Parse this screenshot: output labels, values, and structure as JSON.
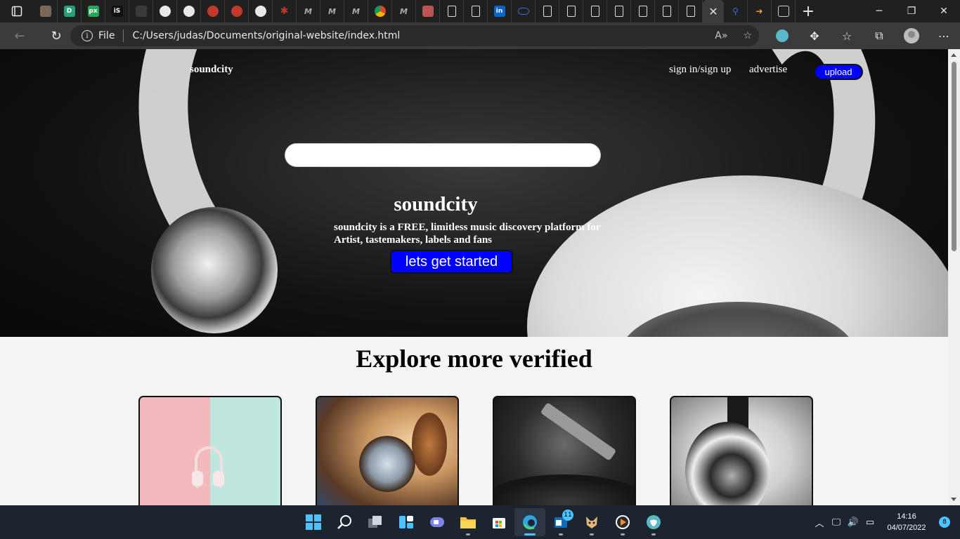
{
  "browser": {
    "tabs": [
      {
        "icon": "cat-icon"
      },
      {
        "icon": "dribbble-icon",
        "text": "D"
      },
      {
        "icon": "px-icon",
        "text": "px"
      },
      {
        "icon": "is-icon",
        "text": "iS"
      },
      {
        "icon": "folder-icon"
      },
      {
        "icon": "github-icon"
      },
      {
        "icon": "github-icon"
      },
      {
        "icon": "record-icon"
      },
      {
        "icon": "record-icon"
      },
      {
        "icon": "github-icon"
      },
      {
        "icon": "asterisk-icon"
      },
      {
        "icon": "medium-icon"
      },
      {
        "icon": "medium-icon"
      },
      {
        "icon": "medium-icon"
      },
      {
        "icon": "chrome-icon"
      },
      {
        "icon": "medium-icon"
      },
      {
        "icon": "doc-icon"
      },
      {
        "icon": "page-icon"
      },
      {
        "icon": "page-icon"
      },
      {
        "icon": "linkedin-icon",
        "text": "in"
      },
      {
        "icon": "cloud-icon"
      },
      {
        "icon": "page-icon"
      },
      {
        "icon": "page-icon"
      },
      {
        "icon": "page-icon"
      },
      {
        "icon": "page-icon"
      },
      {
        "icon": "page-icon"
      },
      {
        "icon": "page-icon"
      },
      {
        "icon": "page-icon"
      }
    ],
    "address": {
      "scheme_label": "File",
      "url": "C:/Users/judas/Documents/original-website/index.html"
    }
  },
  "site": {
    "brand": "soundcity",
    "nav": {
      "signin": "sign in/sign up",
      "advertise": "advertise",
      "upload": "upload"
    },
    "search": {
      "placeholder": ""
    },
    "hero": {
      "title": "soundcity",
      "description": "soundcity is a FREE, limitless music discovery platform for Artist, tastemakers, labels and fans",
      "cta": "lets get started"
    },
    "explore": {
      "title": "Explore more verified",
      "cards": [
        {
          "name": "pink-headphones"
        },
        {
          "name": "orange-headphones"
        },
        {
          "name": "turntable"
        },
        {
          "name": "white-headphones"
        }
      ]
    }
  },
  "taskbar": {
    "clock_time": "14:16",
    "clock_date": "04/07/2022",
    "notifications": "8",
    "app_badge": "11"
  },
  "colors": {
    "accent_button": "#0000ff",
    "page_background": "#f4f4f4",
    "taskbar": "#1c2430"
  }
}
